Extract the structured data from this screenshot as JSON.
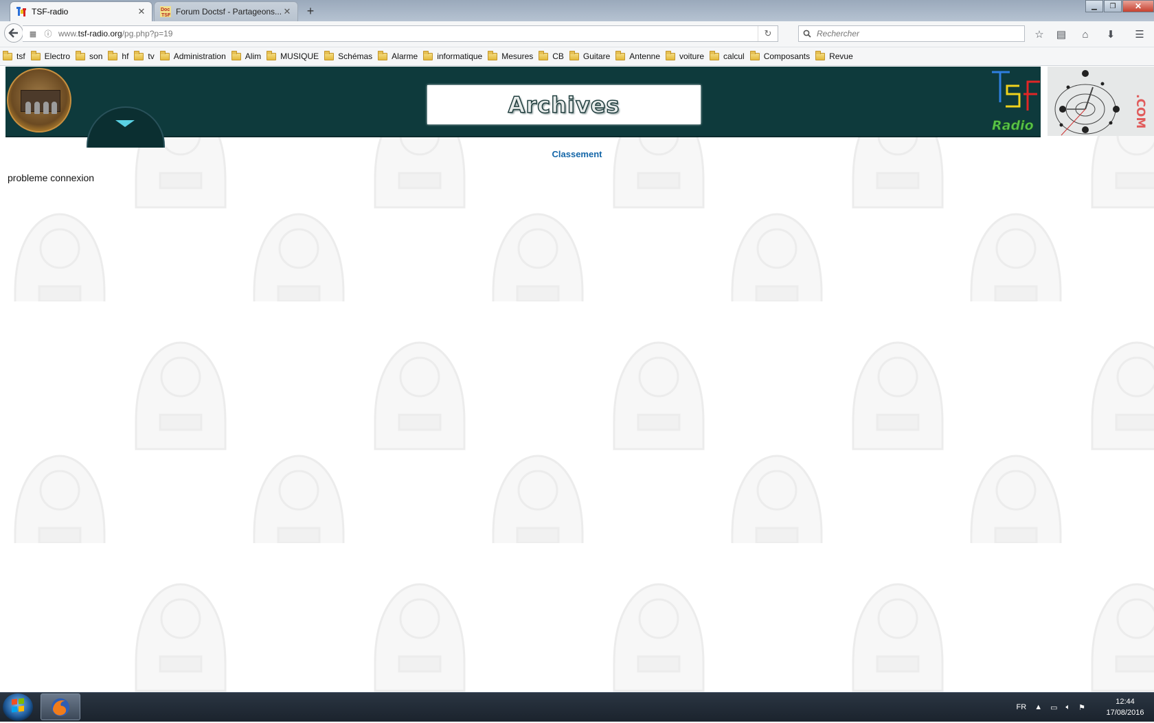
{
  "browser": {
    "tabs": [
      {
        "title": "TSF-radio",
        "active": true,
        "favicon": "tsf-favicon"
      },
      {
        "title": "Forum Doctsf - Partageons...",
        "active": false,
        "favicon": "doc-tsf-favicon"
      }
    ],
    "new_tab_label": "+",
    "url": {
      "prefix": "www.",
      "domain": "tsf-radio.org",
      "path": "/pg.php?p=19"
    },
    "search_placeholder": "Rechercher"
  },
  "bookmarks": [
    {
      "label": "tsf"
    },
    {
      "label": "Electro"
    },
    {
      "label": "son"
    },
    {
      "label": "hf"
    },
    {
      "label": "tv"
    },
    {
      "label": "Administration"
    },
    {
      "label": "Alim"
    },
    {
      "label": "MUSIQUE"
    },
    {
      "label": "Schémas"
    },
    {
      "label": "Alarme"
    },
    {
      "label": "informatique"
    },
    {
      "label": "Mesures"
    },
    {
      "label": "CB"
    },
    {
      "label": "Guitare"
    },
    {
      "label": "Antenne"
    },
    {
      "label": "voiture"
    },
    {
      "label": "calcul"
    },
    {
      "label": "Composants"
    },
    {
      "label": "Revue"
    }
  ],
  "page": {
    "banner_title": "Archives",
    "logo_word": "Radio",
    "logo_domain": ".COM",
    "classement_link": "Classement",
    "status_message": "probleme connexion"
  },
  "taskbar": {
    "language": "FR",
    "time": "12:44",
    "date": "17/08/2016"
  },
  "colors": {
    "banner_bg": "#0e3a3c",
    "link": "#1466a8",
    "taskbar": "#1b232d"
  }
}
